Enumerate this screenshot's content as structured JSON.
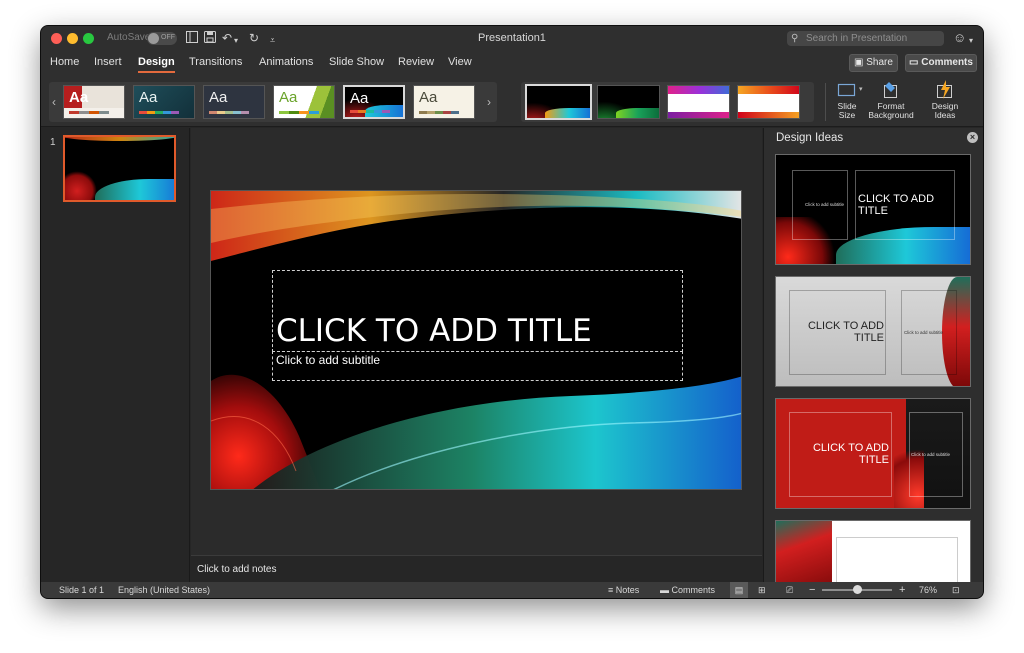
{
  "window": {
    "title": "Presentation1",
    "autosave_label": "AutoSave",
    "autosave_state": "OFF",
    "search_placeholder": "Search in Presentation"
  },
  "tabs": [
    "Home",
    "Insert",
    "Design",
    "Transitions",
    "Animations",
    "Slide Show",
    "Review",
    "View"
  ],
  "active_tab": "Design",
  "share_label": "Share",
  "comments_label": "Comments",
  "themes": {
    "aa_label": "Aa",
    "prev": "‹",
    "next": "›"
  },
  "ribbon_buttons": {
    "slide_size": [
      "Slide",
      "Size"
    ],
    "format_background": [
      "Format",
      "Background"
    ],
    "design_ideas": [
      "Design",
      "Ideas"
    ]
  },
  "slides_pane": {
    "slide_number": "1"
  },
  "slide": {
    "title_placeholder": "CLICK TO ADD TITLE",
    "subtitle_placeholder": "Click to add subtitle"
  },
  "notes_placeholder": "Click to add notes",
  "design_ideas": {
    "title": "Design Ideas",
    "idea1_title": "CLICK TO ADD TITLE",
    "idea1_sub": "Click to add subtitle",
    "idea2_title": "CLICK TO ADD TITLE",
    "idea2_sub": "Click to add subtitle",
    "idea3_title": "CLICK TO ADD TITLE",
    "idea3_sub": "Click to add subtitle"
  },
  "statusbar": {
    "slide_count": "Slide 1 of 1",
    "language": "English (United States)",
    "notes": "Notes",
    "comments": "Comments",
    "zoom_minus": "−",
    "zoom_plus": "+",
    "zoom_level": "76%",
    "zoom_fraction": 0.5
  },
  "colors": {
    "accent": "#e46a3d",
    "window_bg": "#262626"
  }
}
